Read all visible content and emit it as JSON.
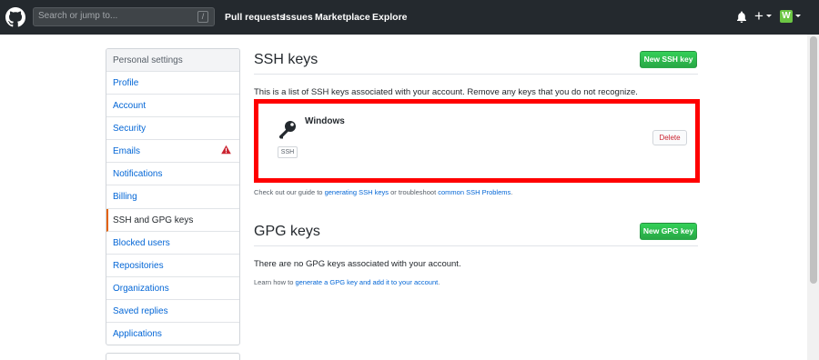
{
  "header": {
    "search_placeholder": "Search or jump to...",
    "search_shortcut": "/",
    "nav": [
      "Pull requests",
      "Issues",
      "Marketplace",
      "Explore"
    ],
    "plus_label": "+",
    "avatar_letter": "W"
  },
  "sidebar": {
    "heading": "Personal settings",
    "items": [
      {
        "label": "Profile"
      },
      {
        "label": "Account"
      },
      {
        "label": "Security"
      },
      {
        "label": "Emails"
      },
      {
        "label": "Notifications"
      },
      {
        "label": "Billing"
      },
      {
        "label": "SSH and GPG keys"
      },
      {
        "label": "Blocked users"
      },
      {
        "label": "Repositories"
      },
      {
        "label": "Organizations"
      },
      {
        "label": "Saved replies"
      },
      {
        "label": "Applications"
      }
    ],
    "selected": "SSH and GPG keys",
    "warning_on": "Emails"
  },
  "ssh": {
    "title": "SSH keys",
    "new_button": "New SSH key",
    "intro": "This is a list of SSH keys associated with your account. Remove any keys that you do not recognize.",
    "key": {
      "name": "Windows",
      "badge": "SSH",
      "delete_label": "Delete"
    },
    "note_prefix": "Check out our guide to ",
    "note_link1": "generating SSH keys",
    "note_middle": " or troubleshoot ",
    "note_link2": "common SSH Problems",
    "note_suffix": "."
  },
  "gpg": {
    "title": "GPG keys",
    "new_button": "New GPG key",
    "empty_text": "There are no GPG keys associated with your account.",
    "note_prefix": "Learn how to ",
    "note_link": "generate a GPG key and add it to your account",
    "note_suffix": "."
  },
  "colors": {
    "header_bg": "#24292e",
    "link": "#0366d6",
    "green": "#2cbe4e",
    "highlight": "#ff0000",
    "danger": "#cb2431",
    "selected_accent": "#e36209"
  }
}
